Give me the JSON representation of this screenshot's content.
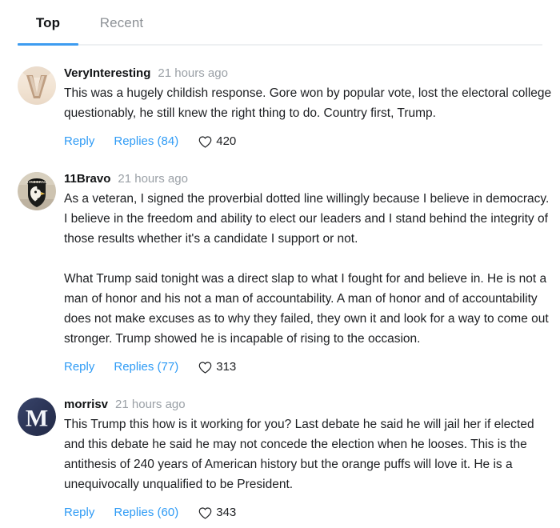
{
  "tabs": [
    {
      "id": "top",
      "label": "Top",
      "active": true
    },
    {
      "id": "recent",
      "label": "Recent",
      "active": false
    }
  ],
  "colors": {
    "accent_blue": "#3d9cf0",
    "link_blue": "#2f9bf5",
    "text_primary": "#1c1e21",
    "text_muted": "#9aa0a6",
    "divider": "#eef0f2"
  },
  "comments": [
    {
      "username": "VeryInteresting",
      "timestamp": "21 hours ago",
      "avatar": {
        "name": "avatar-veryinteresting",
        "type": "letter-v-cream",
        "letter": "V"
      },
      "paragraphs": [
        "This was a hugely childish response. Gore won by popular vote, lost the electoral college questionably, he still knew the right thing to do. Country first, Trump."
      ],
      "reply_label": "Reply",
      "replies_label": "Replies (84)",
      "replies_count": 84,
      "like_count": "420"
    },
    {
      "username": "11Bravo",
      "timestamp": "21 hours ago",
      "avatar": {
        "name": "avatar-11bravo",
        "type": "airborne-patch",
        "letter": ""
      },
      "paragraphs": [
        "As a veteran, I signed the proverbial dotted line willingly because I believe in democracy. I believe in the freedom and ability to elect our leaders and I stand behind the integrity of those results whether it's a candidate I support or not.",
        "What Trump said tonight was a direct slap to what I fought for and believe in. He is not a man of honor and his not a man of accountability. A man of honor and of accountability does not make excuses as to why they failed, they own it and look for a way to come out stronger. Trump showed he is incapable of rising to the occasion."
      ],
      "reply_label": "Reply",
      "replies_label": "Replies (77)",
      "replies_count": 77,
      "like_count": "313"
    },
    {
      "username": "morrisv",
      "timestamp": "21 hours ago",
      "avatar": {
        "name": "avatar-morrisv",
        "type": "letter-m-navy",
        "letter": "M"
      },
      "paragraphs": [
        "This Trump this how is it working for you? Last debate he said he will jail her if elected and this debate he said he may not concede the election when he looses. This is the antithesis of 240 years of American history but the orange puffs will love it. He is a unequivocally unqualified to be President."
      ],
      "reply_label": "Reply",
      "replies_label": "Replies (60)",
      "replies_count": 60,
      "like_count": "343"
    }
  ]
}
